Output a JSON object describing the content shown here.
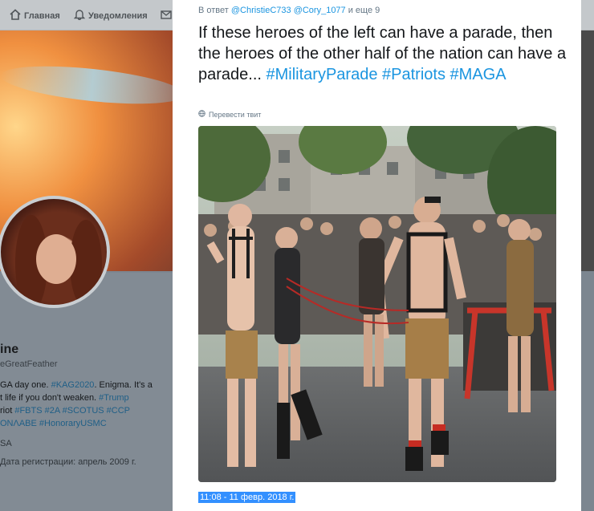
{
  "topnav": {
    "home_label": "Главная",
    "notifications_label": "Уведомления"
  },
  "profile": {
    "name_fragment": "ine",
    "handle_fragment": "eGreatFeather",
    "bio_lines": [
      [
        "GA day one. ",
        "#KAG2020",
        ". Enigma. It's a"
      ],
      [
        "t life if you don't weaken. ",
        "#Trump",
        ""
      ],
      [
        "riot ",
        "#FBTS #2A #SCOTUS #CCP",
        ""
      ],
      [
        "",
        "ΟΝΛΑΒΕ #HonoraryUSMC",
        ""
      ]
    ],
    "location_fragment": "SA",
    "joined_fragment": "Дата регистрации: апрель 2009 г."
  },
  "tweet": {
    "reply_prefix": "В ответ ",
    "reply_mention_1": "@ChristieC733",
    "reply_mention_2": "@Cory_1077",
    "reply_suffix": " и еще 9",
    "text": "If these heroes of the left can have a parade, then the heroes of the other half of the nation can have a parade...",
    "hashtags": [
      "#MilitaryParade",
      "#Patriots",
      "#MAGA"
    ],
    "translate_label": "Перевести твит",
    "timestamp": "11:08 - 11 февр. 2018 г."
  },
  "colors": {
    "link": "#1b95e0",
    "selection": "#3390ff"
  }
}
